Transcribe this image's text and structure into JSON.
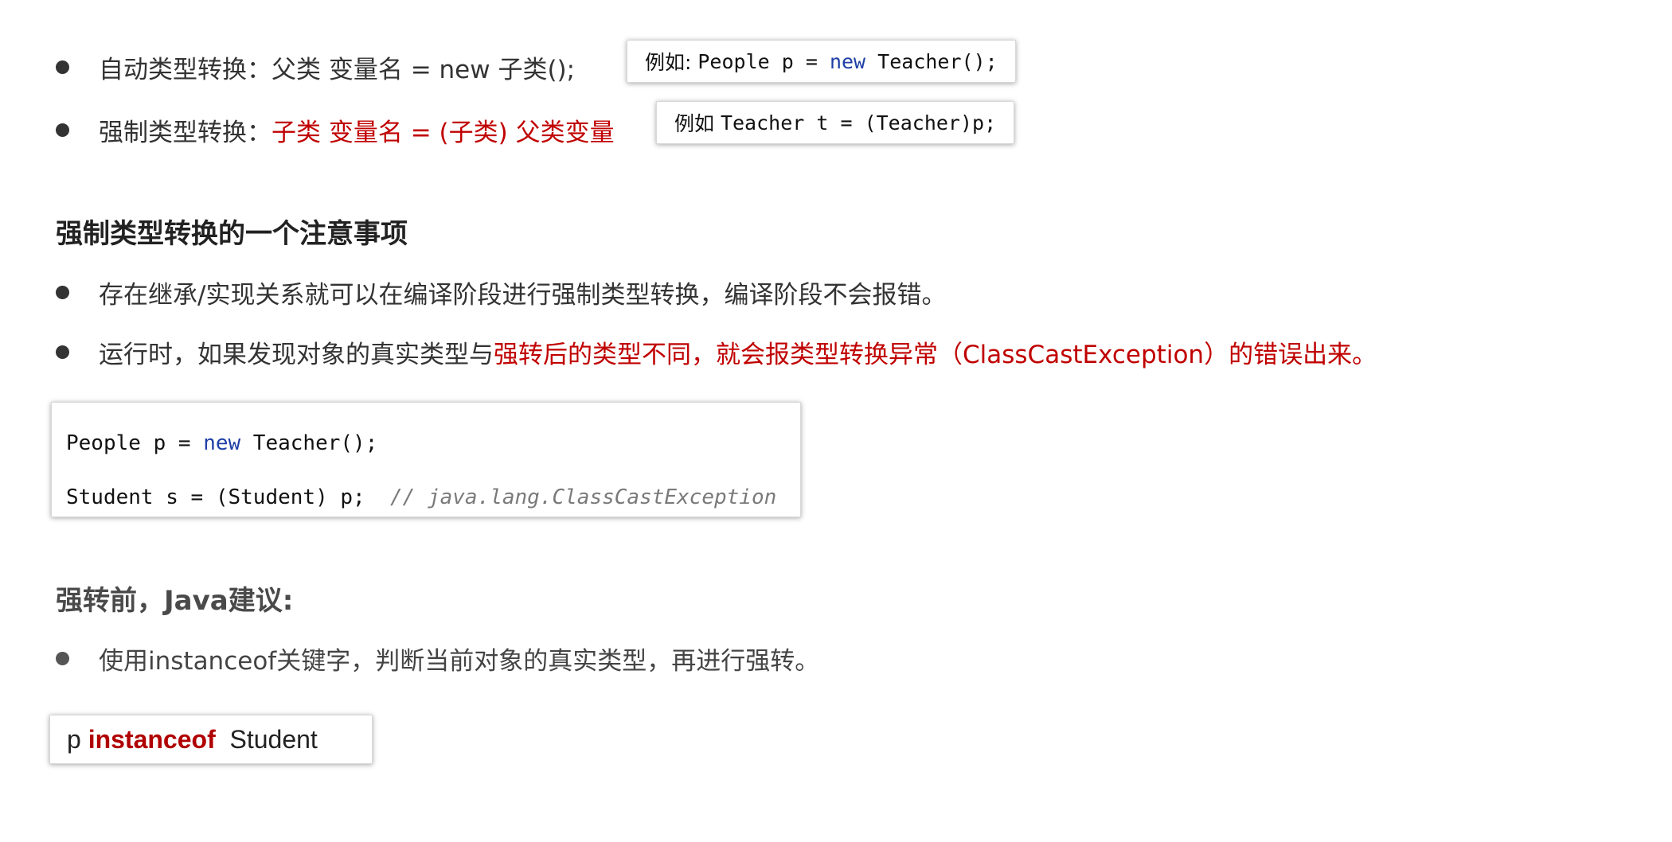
{
  "conversions": {
    "auto": {
      "label": "自动类型转换：",
      "formula": "父类 变量名 = new 子类();",
      "example_prefix": "例如: ",
      "example_pre": "People p = ",
      "example_kw": "new",
      "example_post": " Teacher();"
    },
    "force": {
      "label": "强制类型转换：",
      "formula": "子类 变量名 = (子类) 父类变量",
      "example_prefix": "例如 ",
      "example_code": "Teacher t = (Teacher)p;"
    }
  },
  "notes": {
    "heading": "强制类型转换的一个注意事项",
    "item1": "存在继承/实现关系就可以在编译阶段进行强制类型转换，编译阶段不会报错。",
    "item2_normal": "运行时，如果发现对象的真实类型与",
    "item2_red": "强转后的类型不同，就会报类型转换异常（ClassCastException）的错误出来。"
  },
  "code_block": {
    "line1_pre": "People p = ",
    "line1_kw": "new",
    "line1_post": " Teacher();",
    "line2_code": "Student s = (Student) p;  ",
    "line2_comment": "// java.lang.ClassCastException"
  },
  "advice": {
    "heading": "强转前，Java建议:",
    "item": "使用instanceof关键字，判断当前对象的真实类型，再进行强转。"
  },
  "instanceof_box": {
    "var": "p ",
    "keyword": "instanceof",
    "type": "  Student"
  }
}
